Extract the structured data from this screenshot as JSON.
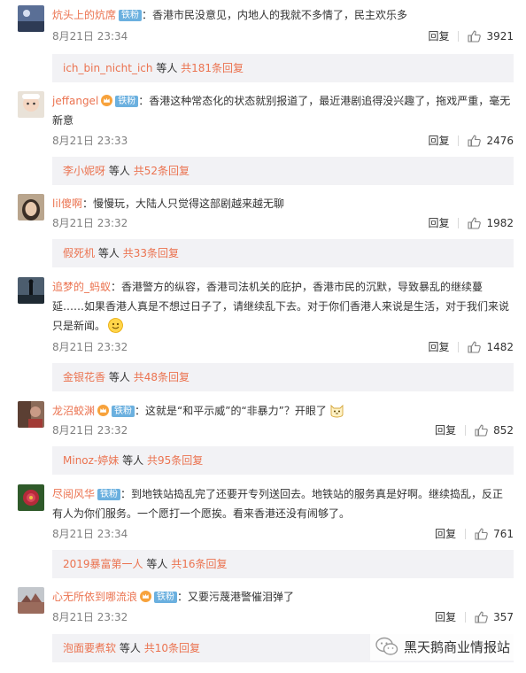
{
  "colors": {
    "username": "#eb7350",
    "badge": "#6bb0df",
    "more_bg": "#f2f2f5",
    "time": "#808080"
  },
  "icons": {
    "like": "thumbs-up-icon",
    "crown": "crown-icon",
    "watermark": "wechat-icon"
  },
  "comments": [
    {
      "user": "炕头上的炕席",
      "badge": "铁粉",
      "has_crown": false,
      "text": "：香港市民没意见，内地人的我就不多情了，民主欢乐多",
      "time": "8月21日 23:34",
      "reply_label": "回复",
      "likes": "3921",
      "more": {
        "user": "ich_bin_nicht_ich",
        "mid": "等人",
        "count": "共181条回复"
      }
    },
    {
      "user": "jeffangel",
      "badge": "铁粉",
      "has_crown": true,
      "text": "：香港这种常态化的状态就别报道了，最近港剧追得没兴趣了，拖戏严重，毫无新意",
      "time": "8月21日 23:33",
      "reply_label": "回复",
      "likes": "2476",
      "more": {
        "user": "李小妮呀",
        "mid": "等人",
        "count": "共52条回复"
      }
    },
    {
      "user": "lil傻啊",
      "badge": "",
      "has_crown": false,
      "text": "：慢慢玩，大陆人只觉得这部剧越来越无聊",
      "time": "8月21日 23:32",
      "reply_label": "回复",
      "likes": "1982",
      "more": {
        "user": "假死机",
        "mid": "等人",
        "count": "共33条回复"
      }
    },
    {
      "user": "追梦的_蚂蚁",
      "badge": "",
      "has_crown": false,
      "text": "：香港警方的纵容，香港司法机关的庇护，香港市民的沉默，导致暴乱的继续蔓延……如果香港人真是不想过日子了，请继续乱下去。对于你们香港人来说是生活，对于我们来说只是新闻。",
      "emoji": "smile-emoji",
      "time": "8月21日 23:32",
      "reply_label": "回复",
      "likes": "1482",
      "more": {
        "user": "金银花香",
        "mid": "等人",
        "count": "共48条回复"
      }
    },
    {
      "user": "龙沼蛟渊",
      "badge": "铁粉",
      "has_crown": true,
      "text": "：这就是“和平示威”的“非暴力”？开眼了",
      "emoji": "cat-emoji",
      "time": "8月21日 23:32",
      "reply_label": "回复",
      "likes": "852",
      "more": {
        "user": "Minoz-婷妹",
        "mid": "等人",
        "count": "共95条回复"
      }
    },
    {
      "user": "尽阅风华",
      "badge": "铁粉",
      "has_crown": false,
      "text": "：到地铁站捣乱完了还要开专列送回去。地铁站的服务真是好啊。继续捣乱，反正有人为你们服务。一个愿打一个愿挨。看来香港还没有闹够了。",
      "time": "8月21日 23:34",
      "reply_label": "回复",
      "likes": "761",
      "more": {
        "user": "2019暴富第一人",
        "mid": "等人",
        "count": "共16条回复"
      }
    },
    {
      "user": "心无所依到哪流浪",
      "badge": "铁粉",
      "has_crown": true,
      "text": "：又要污蔑港警催泪弹了",
      "time": "8月21日 23:32",
      "reply_label": "回复",
      "likes": "357",
      "more": {
        "user": "泡面要煮软",
        "mid": "等人",
        "count": "共10条回复"
      }
    }
  ],
  "watermark": {
    "text": "黑天鹅商业情报站"
  }
}
